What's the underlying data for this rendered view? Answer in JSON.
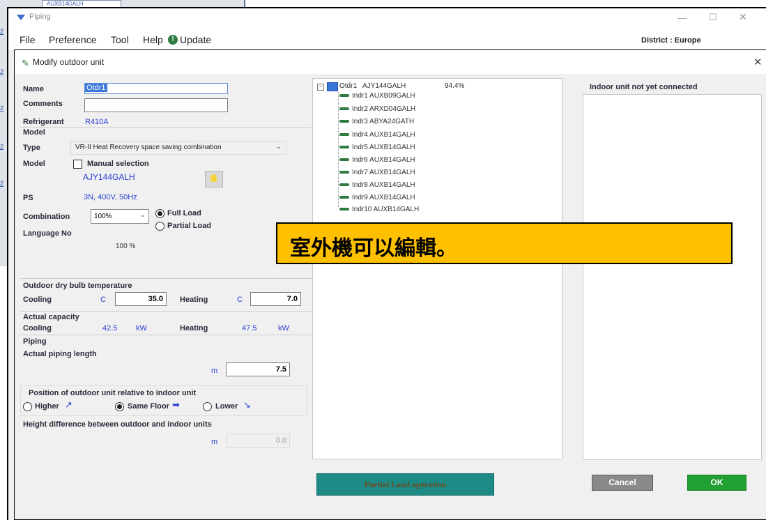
{
  "background": {
    "tab_label": "AUXB14GALH"
  },
  "window": {
    "title": "Piping",
    "district": "District : Europe"
  },
  "menu": [
    "File",
    "Preference",
    "Tool",
    "Help",
    "Update"
  ],
  "dialog": {
    "title": "Modify outdoor unit",
    "name_label": "Name",
    "name_value": "Otdr1",
    "comments_label": "Comments",
    "comments_value": "",
    "refrigerant_label": "Refrigerant",
    "refrigerant_value": "R410A",
    "model_section": "Model",
    "type_label": "Type",
    "type_value": "VR-II Heat Recovery space saving combination",
    "model_label": "Model",
    "manual_selection": "Manual selection",
    "model_value": "AJY144GALH",
    "ps_label": "PS",
    "ps_value": "3N, 400V, 50Hz",
    "combination_label": "Combination",
    "combination_value": "100%",
    "full_load": "Full Load",
    "partial_load": "Partial Load",
    "language_label": "Language No",
    "language_value": "100 %",
    "outdoor_temp_section": "Outdoor dry bulb temperature",
    "cooling_label": "Cooling",
    "heating_label": "Heating",
    "unit_c": "C",
    "cooling_temp": "35.0",
    "heating_temp": "7.0",
    "capacity_section": "Actual capacity",
    "cooling_capacity": "42.5",
    "heating_capacity": "47.5",
    "unit_kw": "kW",
    "piping_section": "Piping",
    "piping_length_label": "Actual piping length",
    "unit_m": "m",
    "piping_length": "7.5",
    "position_label": "Position of outdoor unit relative to indoor unit",
    "higher": "Higher",
    "same_floor": "Same Floor",
    "lower": "Lower",
    "height_diff_label": "Height difference between outdoor and indoor units",
    "height_diff": "0.0",
    "partial_load_button": "Partial Load operation",
    "cancel_button": "Cancel",
    "ok_button": "OK",
    "not_connected_title": "Indoor unit not yet connected"
  },
  "tree": {
    "root_name": "Otdr1",
    "root_model": "AJY144GALH",
    "root_percent": "94.4%",
    "items": [
      "Indr1  AUXB09GALH",
      "Indr2  ARXD04GALH",
      "Indr3  ABYA24GATH",
      "Indr4  AUXB14GALH",
      "Indr5  AUXB14GALH",
      "Indr6  AUXB14GALH",
      "Indr7  AUXB14GALH",
      "Indr8  AUXB14GALH",
      "Indr9  AUXB14GALH",
      "Indr10  AUXB14GALH"
    ]
  },
  "callout": "室外機可以編輯。",
  "colors": {
    "callout_bg": "#ffc000",
    "ok_green": "#22a033",
    "partial_teal": "#1e8a86",
    "value_blue": "#2b3fd6"
  }
}
